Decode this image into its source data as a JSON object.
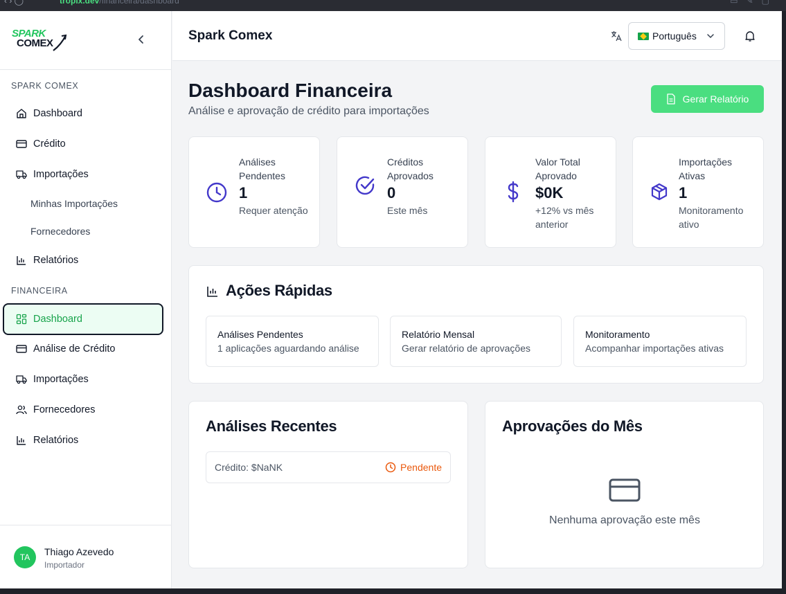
{
  "browser": {
    "url_host": "tropix.dev",
    "url_path": "/financeira/dashboard"
  },
  "sidebar": {
    "logo_line1": "SPARK",
    "logo_line2": "COMEX",
    "section1": "SPARK COMEX",
    "section2": "FINANCEIRA",
    "items1": [
      {
        "label": "Dashboard",
        "icon": "home-icon"
      },
      {
        "label": "Crédito",
        "icon": "credit-card-icon"
      },
      {
        "label": "Importações",
        "icon": "truck-icon"
      },
      {
        "label": "Minhas Importações"
      },
      {
        "label": "Fornecedores"
      },
      {
        "label": "Relatórios",
        "icon": "bar-chart-icon"
      }
    ],
    "items2": [
      {
        "label": "Dashboard",
        "icon": "layout-grid-icon"
      },
      {
        "label": "Análise de Crédito",
        "icon": "credit-card-icon"
      },
      {
        "label": "Importações",
        "icon": "truck-icon"
      },
      {
        "label": "Fornecedores",
        "icon": "users-icon"
      },
      {
        "label": "Relatórios",
        "icon": "bar-chart-icon"
      }
    ],
    "user": {
      "initials": "TA",
      "name": "Thiago Azevedo",
      "role": "Importador"
    }
  },
  "header": {
    "title": "Spark Comex",
    "language": "Português"
  },
  "page": {
    "title": "Dashboard Financeira",
    "subtitle": "Análise e aprovação de crédito para importações",
    "report_button": "Gerar Relatório"
  },
  "stats": [
    {
      "label": "Análises Pendentes",
      "value": "1",
      "note": "Requer atenção",
      "icon": "clock-icon"
    },
    {
      "label": "Créditos Aprovados",
      "value": "0",
      "note": "Este mês",
      "icon": "check-circle-icon"
    },
    {
      "label": "Valor Total Aprovado",
      "value": "$0K",
      "note": "+12% vs mês anterior",
      "icon": "dollar-icon"
    },
    {
      "label": "Importações Ativas",
      "value": "1",
      "note": "Monitoramento ativo",
      "icon": "package-icon"
    }
  ],
  "quick_actions": {
    "title": "Ações Rápidas",
    "items": [
      {
        "title": "Análises Pendentes",
        "desc": "1 aplicações aguardando análise"
      },
      {
        "title": "Relatório Mensal",
        "desc": "Gerar relatório de aprovações"
      },
      {
        "title": "Monitoramento",
        "desc": "Acompanhar importações ativas"
      }
    ]
  },
  "recent": {
    "title": "Análises Recentes",
    "rows": [
      {
        "amount": "Crédito: $NaNK",
        "status": "Pendente"
      }
    ]
  },
  "approvals": {
    "title": "Aprovações do Mês",
    "empty": "Nenhuma aprovação este mês"
  },
  "colors": {
    "accent": "#4ade80",
    "accent_text": "#16a34a",
    "icon_blue": "#4338ca",
    "pending": "#ea580c"
  }
}
